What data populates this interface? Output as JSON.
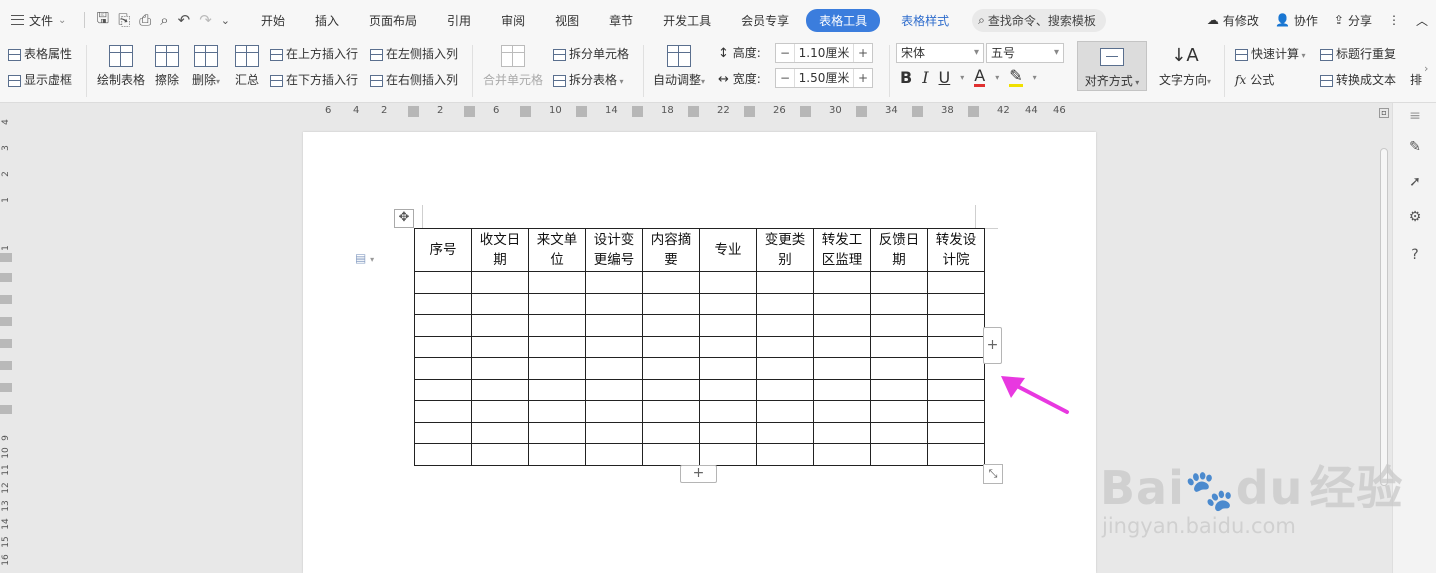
{
  "menubar": {
    "file_label": "文件",
    "tabs": [
      {
        "label": "开始",
        "style": "normal"
      },
      {
        "label": "插入",
        "style": "normal"
      },
      {
        "label": "页面布局",
        "style": "normal"
      },
      {
        "label": "引用",
        "style": "normal"
      },
      {
        "label": "审阅",
        "style": "normal"
      },
      {
        "label": "视图",
        "style": "normal"
      },
      {
        "label": "章节",
        "style": "normal"
      },
      {
        "label": "开发工具",
        "style": "normal"
      },
      {
        "label": "会员专享",
        "style": "normal"
      },
      {
        "label": "表格工具",
        "style": "active"
      },
      {
        "label": "表格样式",
        "style": "blue"
      }
    ],
    "search_placeholder": "查找命令、搜索模板",
    "unsaved_label": "有修改",
    "collab_label": "协作",
    "share_label": "分享",
    "accent_color": "#3b7ddd"
  },
  "ribbon": {
    "table_props": "表格属性",
    "show_gridlines": "显示虚框",
    "draw_table": "绘制表格",
    "erase": "擦除",
    "delete": "删除",
    "summary": "汇总",
    "insert_row_above": "在上方插入行",
    "insert_row_below": "在下方插入行",
    "insert_col_left": "在左侧插入列",
    "insert_col_right": "在右侧插入列",
    "merge_cells": "合并单元格",
    "split_cells": "拆分单元格",
    "split_table": "拆分表格",
    "auto_fit": "自动调整",
    "height_label": "高度:",
    "height_value": "1.10厘米",
    "width_label": "宽度:",
    "width_value": "1.50厘米",
    "font_name": "宋体",
    "font_size": "五号",
    "align": "对齐方式",
    "text_direction": "文字方向",
    "quick_calc": "快速计算",
    "formula": "公式",
    "repeat_header": "标题行重复",
    "convert_text": "转换成文本",
    "sort_partial": "排"
  },
  "ruler": {
    "labels": [
      "6",
      "4",
      "2",
      "2",
      "6",
      "10",
      "14",
      "18",
      "22",
      "26",
      "30",
      "34",
      "38",
      "42",
      "44",
      "46"
    ],
    "vlabels": [
      "4",
      "3",
      "2",
      "1",
      "1",
      "9",
      "10",
      "11",
      "12",
      "13",
      "14",
      "15",
      "16"
    ]
  },
  "table": {
    "headers": [
      [
        "序号"
      ],
      [
        "收文日",
        "期"
      ],
      [
        "来文单",
        "位"
      ],
      [
        "设计变",
        "更编号"
      ],
      [
        "内容摘",
        "要"
      ],
      [
        "专业"
      ],
      [
        "变更类",
        "别"
      ],
      [
        "转发工",
        "区监理"
      ],
      [
        "反馈日",
        "期"
      ],
      [
        "转发设",
        "计院"
      ]
    ],
    "empty_rows": 9
  },
  "controls": {
    "add_col_glyph": "+",
    "add_row_glyph": "+"
  },
  "watermark": {
    "brand": "Bai",
    "brand2": "du",
    "brand_cn": "经验",
    "url": "jingyan.baidu.com"
  },
  "annotation": {
    "arrow_color": "#e838e0"
  }
}
